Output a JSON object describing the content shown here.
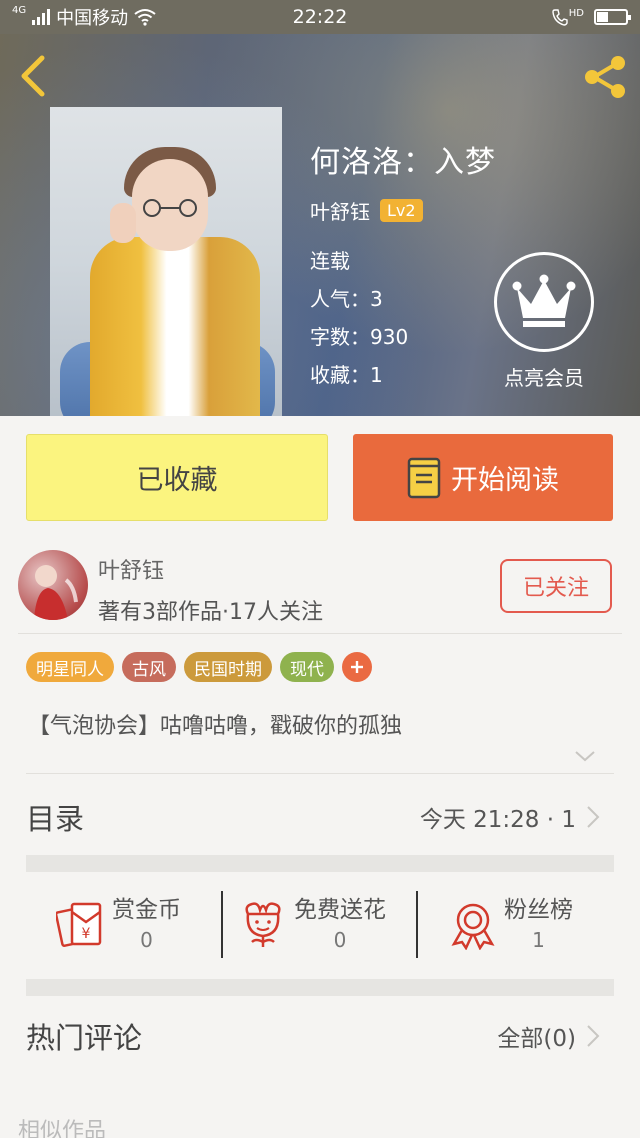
{
  "status_bar": {
    "network": "4G",
    "carrier": "中国移动",
    "time": "22:22",
    "volte": "HD",
    "battery_level": 0.4
  },
  "header": {
    "back_icon": "chevron-left-icon",
    "share_icon": "share-icon",
    "title": "何洛洛：入梦",
    "author": "叶舒钰",
    "level": "Lv2",
    "status": "连载",
    "popularity": "人气：3",
    "word_count": "字数：930",
    "favorites": "收藏：1",
    "vip_label": "点亮会员",
    "vip_icon": "crown-icon"
  },
  "actions": {
    "favorited_label": "已收藏",
    "read_label": "开始阅读",
    "read_icon": "book-icon"
  },
  "author_card": {
    "name": "叶舒钰",
    "stats": "著有3部作品·17人关注",
    "follow_label": "已关注"
  },
  "tags": [
    {
      "label": "明星同人",
      "color": "#f0a93c"
    },
    {
      "label": "古风",
      "color": "#c66c5c"
    },
    {
      "label": "民国时期",
      "color": "#cc9a3c"
    },
    {
      "label": "现代",
      "color": "#8fb24e"
    }
  ],
  "description": "【气泡协会】咕噜咕噜，戳破你的孤独",
  "catalog": {
    "label": "目录",
    "latest": "今天 21:28 · 1"
  },
  "stats": [
    {
      "label": "赏金币",
      "value": "0",
      "icon": "red-envelope-icon"
    },
    {
      "label": "免费送花",
      "value": "0",
      "icon": "flower-icon"
    },
    {
      "label": "粉丝榜",
      "value": "1",
      "icon": "ribbon-medal-icon"
    }
  ],
  "comments": {
    "label": "热门评论",
    "all_label": "全部(0)"
  },
  "similar_label": "相似作品",
  "colors": {
    "accent_orange": "#e96a3d",
    "favorite_yellow": "#fbf47f",
    "follow_red": "#e35a4e",
    "icon_red": "#d23a2c"
  }
}
